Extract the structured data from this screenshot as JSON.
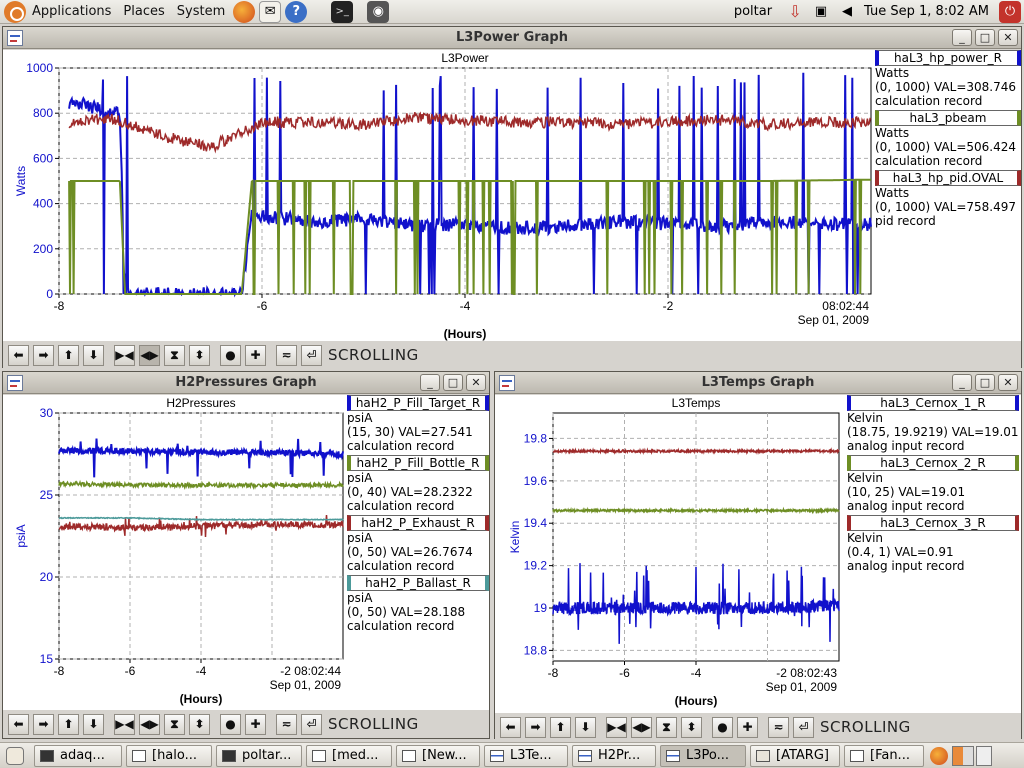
{
  "top_panel": {
    "menus": [
      "Applications",
      "Places",
      "System"
    ],
    "user": "poltar",
    "clock": "Tue Sep  1,  8:02 AM"
  },
  "windows": {
    "power": {
      "title": "L3Power Graph",
      "plot_title": "L3Power",
      "ylabel": "Watts",
      "xlabel": "(Hours)",
      "time_label": "08:02:44",
      "date_label": "Sep 01, 2009",
      "yticks": [
        "1000",
        "800",
        "600",
        "400",
        "200",
        "0"
      ],
      "xticks": [
        "-8",
        "-6",
        "-4",
        "-2"
      ],
      "status": "SCROLLING",
      "legend": [
        {
          "name": "haL3_hp_power_R",
          "units": "Watts",
          "value": "(0, 1000) VAL=308.746",
          "type": "calculation record",
          "color": "#1111cc"
        },
        {
          "name": "haL3_pbeam",
          "units": "Watts",
          "value": "(0, 1000) VAL=506.424",
          "type": "calculation record",
          "color": "#6e8e24"
        },
        {
          "name": "haL3_hp_pid.OVAL",
          "units": "Watts",
          "value": "(0, 1000) VAL=758.497",
          "type": "pid record",
          "color": "#9e2a2a"
        }
      ]
    },
    "pressures": {
      "title": "H2Pressures Graph",
      "plot_title": "H2Pressures",
      "ylabel": "psiA",
      "xlabel": "(Hours)",
      "time_label": "-2 08:02:44",
      "date_label": "Sep 01, 2009",
      "yticks": [
        "30",
        "25",
        "20",
        "15"
      ],
      "xticks": [
        "-8",
        "-6",
        "-4"
      ],
      "status": "SCROLLING",
      "legend": [
        {
          "name": "haH2_P_Fill_Target_R",
          "units": "psiA",
          "value": "(15, 30) VAL=27.541",
          "type": "calculation record",
          "color": "#1111cc"
        },
        {
          "name": "haH2_P_Fill_Bottle_R",
          "units": "psiA",
          "value": "(0, 40) VAL=28.2322",
          "type": "calculation record",
          "color": "#6e8e24"
        },
        {
          "name": "haH2_P_Exhaust_R",
          "units": "psiA",
          "value": "(0, 50) VAL=26.7674",
          "type": "calculation record",
          "color": "#9e2a2a"
        },
        {
          "name": "haH2_P_Ballast_R",
          "units": "psiA",
          "value": "(0, 50) VAL=28.188",
          "type": "calculation record",
          "color": "#4c9a9a"
        }
      ]
    },
    "temps": {
      "title": "L3Temps Graph",
      "plot_title": "L3Temps",
      "ylabel": "Kelvin",
      "xlabel": "(Hours)",
      "time_label": "-2 08:02:43",
      "date_label": "Sep 01, 2009",
      "yticks": [
        "19.8",
        "19.6",
        "19.4",
        "19.2",
        "19",
        "18.8"
      ],
      "xticks": [
        "-8",
        "-6",
        "-4"
      ],
      "status": "SCROLLING",
      "legend": [
        {
          "name": "haL3_Cernox_1_R",
          "units": "Kelvin",
          "value": "(18.75, 19.9219) VAL=19.01",
          "type": "analog input record",
          "color": "#1111cc"
        },
        {
          "name": "haL3_Cernox_2_R",
          "units": "Kelvin",
          "value": "(10, 25) VAL=19.01",
          "type": "analog input record",
          "color": "#6e8e24"
        },
        {
          "name": "haL3_Cernox_3_R",
          "units": "Kelvin",
          "value": "(0.4, 1) VAL=0.91",
          "type": "analog input record",
          "color": "#9e2a2a"
        }
      ]
    }
  },
  "chart_data": [
    {
      "type": "line",
      "title": "L3Power",
      "xlabel": "(Hours)",
      "ylabel": "Watts",
      "xlim": [
        -8.0,
        0
      ],
      "ylim": [
        0,
        1000
      ],
      "grid": true,
      "legend_placement": "right",
      "series": [
        {
          "name": "haL3_hp_power_R",
          "color": "#1111cc",
          "x": [
            -7.9,
            -7.4,
            -7.35,
            -6.2,
            -6.1,
            -5.5,
            -5,
            -4.5,
            -4,
            -3.5,
            -3,
            -2.5,
            -2,
            -1.5,
            -1,
            -0.5,
            0
          ],
          "y": [
            850,
            800,
            0,
            0,
            350,
            320,
            330,
            300,
            310,
            290,
            300,
            320,
            310,
            300,
            320,
            310,
            309
          ]
        },
        {
          "name": "haL3_pbeam",
          "color": "#6e8e24",
          "x": [
            -7.9,
            -7.4,
            -7.35,
            -6.2,
            -6.1,
            -5,
            -4,
            -3,
            -2,
            -1,
            0
          ],
          "y": [
            500,
            500,
            0,
            0,
            500,
            500,
            500,
            500,
            500,
            500,
            506
          ]
        },
        {
          "name": "haL3_hp_pid.OVAL",
          "color": "#9e2a2a",
          "x": [
            -7.9,
            -7.5,
            -7,
            -6.5,
            -6,
            -5.5,
            -5,
            -4.5,
            -4,
            -3.5,
            -3,
            -2.5,
            -2,
            -1.5,
            -1,
            -0.5,
            0
          ],
          "y": [
            760,
            780,
            700,
            650,
            760,
            760,
            750,
            780,
            770,
            760,
            760,
            750,
            760,
            770,
            750,
            760,
            758
          ]
        }
      ]
    },
    {
      "type": "line",
      "title": "H2Pressures",
      "xlabel": "(Hours)",
      "ylabel": "psiA",
      "xlim": [
        -8.0,
        0
      ],
      "ylim": [
        15,
        30
      ],
      "grid": true,
      "legend_placement": "right",
      "series": [
        {
          "name": "haH2_P_Fill_Target_R",
          "color": "#1111cc",
          "x": [
            -8,
            -6,
            -4,
            -2,
            0
          ],
          "y": [
            27.7,
            27.7,
            27.6,
            27.6,
            27.5
          ]
        },
        {
          "name": "haH2_P_Fill_Bottle_R",
          "color": "#6e8e24",
          "x": [
            -8,
            -6,
            -4,
            -2,
            0
          ],
          "y": [
            25.7,
            25.6,
            25.6,
            25.6,
            25.6
          ]
        },
        {
          "name": "haH2_P_Exhaust_R",
          "color": "#9e2a2a",
          "x": [
            -8,
            -6,
            -4,
            -2,
            0
          ],
          "y": [
            23.1,
            23.0,
            23.1,
            23.2,
            23.2
          ]
        },
        {
          "name": "haH2_P_Ballast_R",
          "color": "#4c9a9a",
          "x": [
            -8,
            -6,
            -4,
            -2,
            0
          ],
          "y": [
            23.6,
            23.6,
            23.5,
            23.5,
            23.5
          ]
        }
      ]
    },
    {
      "type": "line",
      "title": "L3Temps",
      "xlabel": "(Hours)",
      "ylabel": "Kelvin",
      "xlim": [
        -8.0,
        0
      ],
      "ylim": [
        18.75,
        19.92
      ],
      "grid": true,
      "legend_placement": "right",
      "series": [
        {
          "name": "haL3_Cernox_1_R",
          "color": "#1111cc",
          "x": [
            -8,
            -6,
            -4,
            -2,
            0
          ],
          "y": [
            19.0,
            19.0,
            19.0,
            19.0,
            19.01
          ]
        },
        {
          "name": "haL3_Cernox_2_R",
          "color": "#6e8e24",
          "x": [
            -8,
            -6,
            -4,
            -2,
            0
          ],
          "y": [
            19.46,
            19.46,
            19.46,
            19.46,
            19.46
          ]
        },
        {
          "name": "haL3_Cernox_3_R",
          "color": "#9e2a2a",
          "x": [
            -8,
            -6,
            -4,
            -2,
            0
          ],
          "y": [
            19.74,
            19.74,
            19.74,
            19.74,
            19.74
          ]
        }
      ]
    }
  ],
  "taskbar": {
    "items": [
      {
        "label": "adaq...",
        "icon": "terminal-icon"
      },
      {
        "label": "[halo...",
        "icon": "window-icon"
      },
      {
        "label": "poltar...",
        "icon": "terminal-icon"
      },
      {
        "label": "[med...",
        "icon": "window-icon"
      },
      {
        "label": "[New...",
        "icon": "window-icon"
      },
      {
        "label": "L3Te...",
        "icon": "graph-icon"
      },
      {
        "label": "H2Pr...",
        "icon": "graph-icon"
      },
      {
        "label": "L3Po...",
        "icon": "graph-icon"
      },
      {
        "label": "[ATARG]",
        "icon": "doc-icon"
      },
      {
        "label": "[Fan...",
        "icon": "window-icon"
      }
    ]
  }
}
